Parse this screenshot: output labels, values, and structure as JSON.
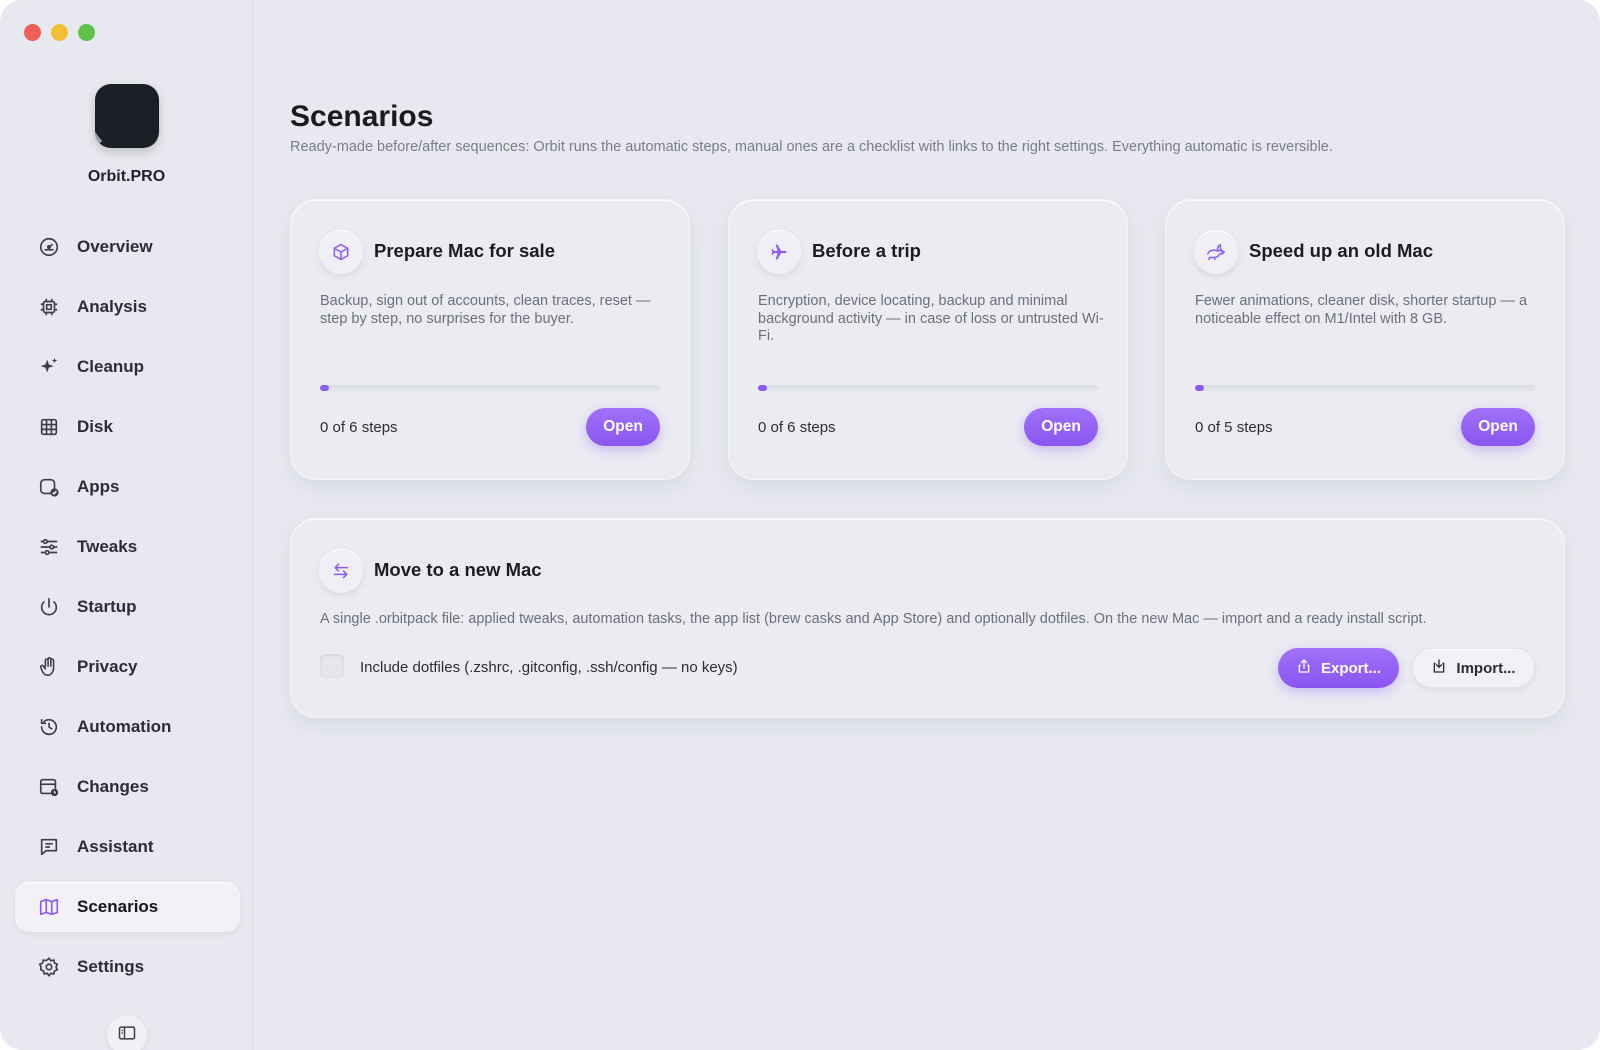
{
  "app": {
    "name": "Orbit.PRO",
    "accent": "#8b5cf6"
  },
  "sidebar": {
    "items": [
      {
        "label": "Overview",
        "icon": "gauge-icon"
      },
      {
        "label": "Analysis",
        "icon": "chip-icon"
      },
      {
        "label": "Cleanup",
        "icon": "sparkles-icon"
      },
      {
        "label": "Disk",
        "icon": "grid-icon"
      },
      {
        "label": "Apps",
        "icon": "app-check-icon"
      },
      {
        "label": "Tweaks",
        "icon": "sliders-icon"
      },
      {
        "label": "Startup",
        "icon": "power-icon"
      },
      {
        "label": "Privacy",
        "icon": "hand-icon"
      },
      {
        "label": "Automation",
        "icon": "history-icon"
      },
      {
        "label": "Changes",
        "icon": "calendar-clock-icon"
      },
      {
        "label": "Assistant",
        "icon": "chat-icon"
      },
      {
        "label": "Scenarios",
        "icon": "map-icon",
        "active": true
      },
      {
        "label": "Settings",
        "icon": "gear-icon"
      }
    ]
  },
  "page": {
    "title": "Scenarios",
    "subtitle": "Ready-made before/after sequences: Orbit runs the automatic steps, manual ones are a checklist with links to the right settings. Everything automatic is reversible."
  },
  "scenarios": [
    {
      "title": "Prepare Mac for sale",
      "icon": "box-icon",
      "description": "Backup, sign out of accounts, clean traces, reset — step by step, no surprises for the buyer.",
      "steps": "0 of 6 steps",
      "progress": 0,
      "button": "Open"
    },
    {
      "title": "Before a trip",
      "icon": "airplane-icon",
      "description": "Encryption, device locating, backup and minimal background activity — in case of loss or untrusted Wi-Fi.",
      "steps": "0 of 6 steps",
      "progress": 0,
      "button": "Open"
    },
    {
      "title": "Speed up an old Mac",
      "icon": "rabbit-icon",
      "description": "Fewer animations, cleaner disk, shorter startup — a noticeable effect on M1/Intel with 8 GB.",
      "steps": "0 of 5 steps",
      "progress": 0,
      "button": "Open"
    }
  ],
  "migrate": {
    "title": "Move to a new Mac",
    "icon": "arrows-swap-icon",
    "description": "A single .orbitpack file: applied tweaks, automation tasks, the app list (brew casks and App Store) and optionally dotfiles. On the new Mac — import and a ready install script.",
    "checkbox_label": "Include dotfiles (.zshrc, .gitconfig, .ssh/config — no keys)",
    "checkbox_checked": false,
    "export_label": "Export...",
    "import_label": "Import..."
  }
}
